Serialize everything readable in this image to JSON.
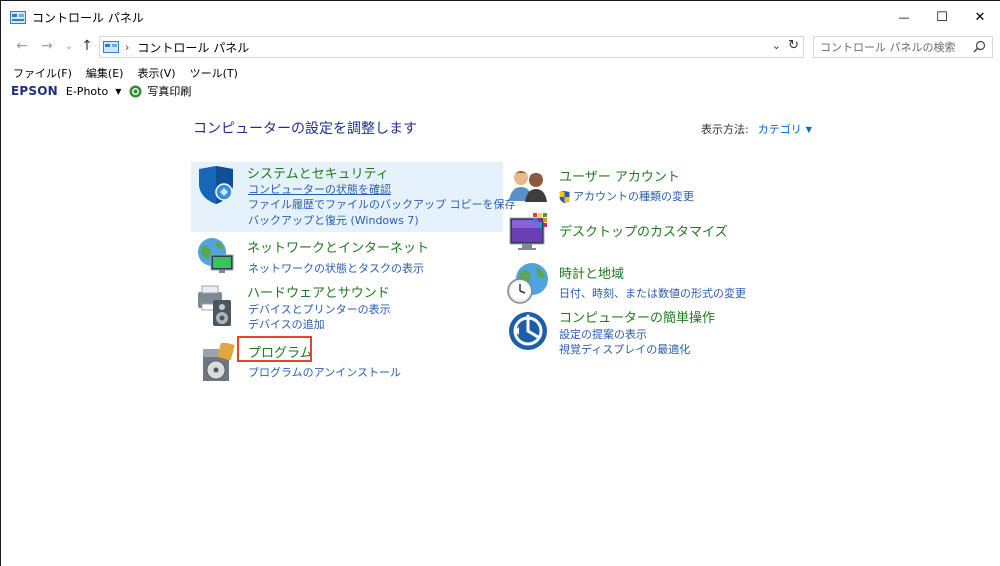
{
  "window": {
    "title": "コントロール パネル",
    "minimize_glyph": "—",
    "maximize_glyph": "☐",
    "close_glyph": "✕"
  },
  "nav": {
    "back_glyph": "←",
    "forward_glyph": "→",
    "recent_glyph": "⌄",
    "up_glyph": "↑",
    "breadcrumb_sep": "›",
    "breadcrumb": "コントロール パネル",
    "dropdown_glyph": "⌄",
    "refresh_glyph": "↻",
    "search_placeholder": "コントロール パネルの検索"
  },
  "menubar": {
    "items": [
      "ファイル(F)",
      "編集(E)",
      "表示(V)",
      "ツール(T)"
    ]
  },
  "epson_toolbar": {
    "brand": "EPSON",
    "app": "E-Photo",
    "app_dropdown_glyph": "▼",
    "print": "写真印刷"
  },
  "content": {
    "heading": "コンピューターの設定を調整します",
    "view_by_label": "表示方法:",
    "view_by_value": "カテゴリ",
    "view_by_glyph": "▼",
    "left": [
      {
        "title": "システムとセキュリティ",
        "links": [
          "コンピューターの状態を確認",
          "ファイル履歴でファイルのバックアップ コピーを保存",
          "バックアップと復元 (Windows 7)"
        ]
      },
      {
        "title": "ネットワークとインターネット",
        "links": [
          "ネットワークの状態とタスクの表示"
        ]
      },
      {
        "title": "ハードウェアとサウンド",
        "links": [
          "デバイスとプリンターの表示",
          "デバイスの追加"
        ]
      },
      {
        "title": "プログラム",
        "links": [
          "プログラムのアンインストール"
        ]
      }
    ],
    "right": [
      {
        "title": "ユーザー アカウント",
        "links": [
          "アカウントの種類の変更"
        ]
      },
      {
        "title": "デスクトップのカスタマイズ",
        "links": []
      },
      {
        "title": "時計と地域",
        "links": [
          "日付、時刻、または数値の形式の変更"
        ]
      },
      {
        "title": "コンピューターの簡単操作",
        "links": [
          "設定の提案の表示",
          "視覚ディスプレイの最適化"
        ]
      }
    ]
  },
  "colors": {
    "category_title": "#1e7a1e",
    "link": "#2a5db0",
    "heading": "#1e3287",
    "hover_bg": "#e6f2fb",
    "annotation_box": "#e8432b"
  }
}
